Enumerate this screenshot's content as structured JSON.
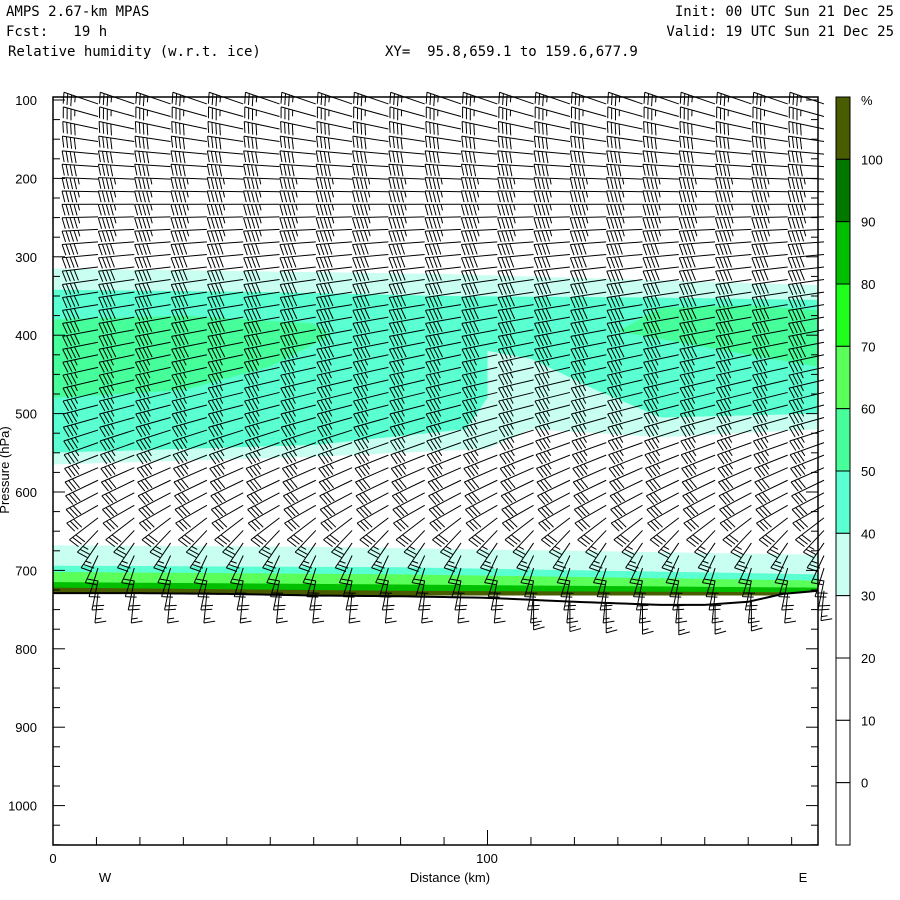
{
  "header": {
    "model": "AMPS 2.67-km MPAS",
    "fcst": "Fcst:   19 h",
    "field": "Relative humidity (w.r.t. ice)",
    "xy": "XY=  95.8,659.1 to 159.6,677.9",
    "init": "Init: 00 UTC Sun 21 Dec 25",
    "valid": "Valid: 19 UTC Sun 21 Dec 25"
  },
  "chart_data": {
    "type": "heatmap",
    "title": "Relative humidity (w.r.t. ice)",
    "xlabel": "Distance (km)",
    "ylabel": "Pressure (hPa)",
    "xlim": [
      0,
      176
    ],
    "ylim": [
      1050,
      96
    ],
    "x_ticks": [
      {
        "value": 0,
        "label": "0"
      },
      {
        "value": 100,
        "label": "100"
      }
    ],
    "x_minor_step": 10,
    "y_ticks": [
      100,
      200,
      300,
      400,
      500,
      600,
      700,
      800,
      900,
      1000
    ],
    "y_tick_labels": [
      "100",
      "200",
      "300",
      "400",
      "500",
      "600",
      "700",
      "800",
      "900",
      "1000"
    ],
    "west_label": "W",
    "east_label": "E",
    "colorbar": {
      "unit": "%",
      "labels": [
        "100",
        "90",
        "80",
        "70",
        "60",
        "50",
        "40",
        "30",
        "20",
        "10",
        "0"
      ],
      "colors": [
        "#4a5c00",
        "#007800",
        "#00be00",
        "#1eff1e",
        "#5aff5a",
        "#46ff9a",
        "#5affd2",
        "#c8fff0",
        "#ffffff",
        "#ffffff",
        "#ffffff",
        "#ffffff"
      ]
    },
    "rh_regions": [
      {
        "range": "30-40",
        "color": "#c8fff0",
        "points": [
          [
            0,
            315
          ],
          [
            40,
            318
          ],
          [
            90,
            322
          ],
          [
            140,
            330
          ],
          [
            176,
            336
          ],
          [
            176,
            520
          ],
          [
            140,
            530
          ],
          [
            110,
            520
          ],
          [
            100,
            545
          ],
          [
            60,
            555
          ],
          [
            0,
            565
          ]
        ]
      },
      {
        "range": "40-50",
        "color": "#5affd2",
        "points": [
          [
            0,
            342
          ],
          [
            50,
            345
          ],
          [
            90,
            350
          ],
          [
            140,
            352
          ],
          [
            176,
            355
          ],
          [
            176,
            500
          ],
          [
            140,
            505
          ],
          [
            125,
            470
          ],
          [
            110,
            430
          ],
          [
            100,
            420
          ],
          [
            100,
            480
          ],
          [
            95,
            520
          ],
          [
            60,
            540
          ],
          [
            0,
            550
          ]
        ]
      },
      {
        "range": "50-60",
        "color": "#46ff9a",
        "points": [
          [
            0,
            380
          ],
          [
            30,
            375
          ],
          [
            60,
            385
          ],
          [
            64,
            400
          ],
          [
            50,
            440
          ],
          [
            30,
            470
          ],
          [
            0,
            480
          ]
        ]
      },
      {
        "range": "50-60",
        "color": "#46ff9a",
        "points": [
          [
            140,
            365
          ],
          [
            160,
            362
          ],
          [
            176,
            368
          ],
          [
            176,
            440
          ],
          [
            160,
            425
          ],
          [
            145,
            410
          ],
          [
            130,
            395
          ]
        ]
      },
      {
        "range": "30-40 low",
        "color": "#c8fff0",
        "points": [
          [
            0,
            668
          ],
          [
            60,
            670
          ],
          [
            120,
            675
          ],
          [
            176,
            680
          ],
          [
            176,
            720
          ],
          [
            0,
            720
          ]
        ]
      },
      {
        "range": "40-50 low",
        "color": "#5affd2",
        "points": [
          [
            0,
            694
          ],
          [
            80,
            696
          ],
          [
            176,
            705
          ],
          [
            176,
            722
          ],
          [
            0,
            722
          ]
        ]
      },
      {
        "range": "60-70 low",
        "color": "#5aff5a",
        "points": [
          [
            0,
            702
          ],
          [
            80,
            705
          ],
          [
            176,
            713
          ],
          [
            176,
            726
          ],
          [
            0,
            726
          ]
        ]
      },
      {
        "range": "80-90 low",
        "color": "#00be00",
        "points": [
          [
            0,
            715
          ],
          [
            80,
            718
          ],
          [
            176,
            722
          ],
          [
            176,
            728
          ],
          [
            0,
            728
          ]
        ]
      },
      {
        "range": "100+ low",
        "color": "#4a5c00",
        "points": [
          [
            0,
            722
          ],
          [
            80,
            726
          ],
          [
            176,
            728
          ],
          [
            176,
            732
          ],
          [
            0,
            732
          ]
        ]
      }
    ],
    "terrain_hPa": [
      [
        0,
        729
      ],
      [
        20,
        729
      ],
      [
        40,
        730
      ],
      [
        60,
        732
      ],
      [
        80,
        733
      ],
      [
        100,
        735
      ],
      [
        120,
        740
      ],
      [
        140,
        744
      ],
      [
        150,
        744
      ],
      [
        160,
        740
      ],
      [
        168,
        730
      ],
      [
        176,
        726
      ]
    ],
    "wind_profile": [
      {
        "p": 100,
        "speed_kt": 35,
        "dir": 290
      },
      {
        "p": 170,
        "speed_kt": 40,
        "dir": 275
      },
      {
        "p": 230,
        "speed_kt": 45,
        "dir": 270
      },
      {
        "p": 330,
        "speed_kt": 40,
        "dir": 262
      },
      {
        "p": 500,
        "speed_kt": 35,
        "dir": 255
      },
      {
        "p": 620,
        "speed_kt": 30,
        "dir": 240
      },
      {
        "p": 690,
        "speed_kt": 20,
        "dir": 200
      },
      {
        "p": 745,
        "speed_kt": 15,
        "dir": 180
      }
    ]
  }
}
